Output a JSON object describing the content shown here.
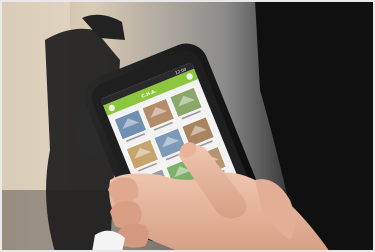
{
  "phone_ui": {
    "status_time": "12:00",
    "header_title": "C.H.A.",
    "screen_accent": "#8cc63f",
    "screen_background": "#f2f2f2",
    "grid_tiles": [
      {
        "icon": "house-icon"
      },
      {
        "icon": "building-icon"
      },
      {
        "icon": "room-icon"
      },
      {
        "icon": "outdoor-icon"
      },
      {
        "icon": "house-icon"
      },
      {
        "icon": "furniture-icon"
      },
      {
        "icon": "store-icon"
      },
      {
        "icon": "garden-icon"
      },
      {
        "icon": "room-icon"
      }
    ],
    "home_button_icon": "power-icon"
  },
  "scene": {
    "background_color": "#d8c9b3",
    "device_color": "#161616",
    "skin_color": "#e7b7a1"
  }
}
